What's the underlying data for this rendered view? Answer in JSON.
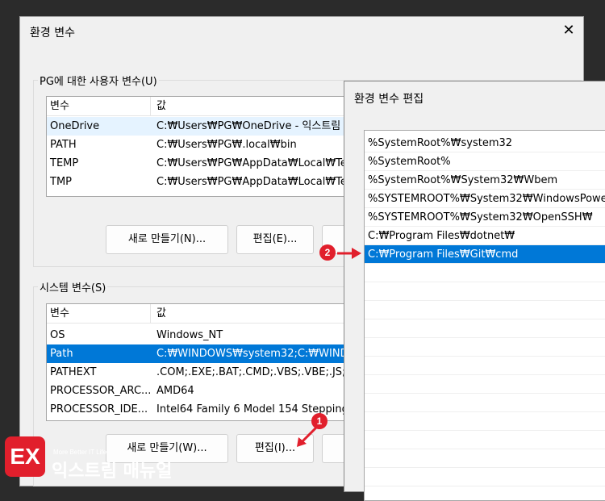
{
  "env_window": {
    "title": "환경 변수",
    "close_glyph": "✕",
    "user_group": {
      "label": "PG에 대한 사용자 변수(U)",
      "columns": [
        "변수",
        "값"
      ],
      "rows": [
        {
          "name": "OneDrive",
          "value": "C:₩Users₩PG₩OneDrive - 익스트림"
        },
        {
          "name": "PATH",
          "value": "C:₩Users₩PG₩.local₩bin"
        },
        {
          "name": "TEMP",
          "value": "C:₩Users₩PG₩AppData₩Local₩Tem"
        },
        {
          "name": "TMP",
          "value": "C:₩Users₩PG₩AppData₩Local₩Tem"
        }
      ],
      "new_button": "새로 만들기(N)...",
      "edit_button": "편집(E)..."
    },
    "system_group": {
      "label": "시스템 변수(S)",
      "columns": [
        "변수",
        "값"
      ],
      "rows": [
        {
          "name": "OS",
          "value": "Windows_NT"
        },
        {
          "name": "Path",
          "value": "C:₩WINDOWS₩system32;C:₩WINDO"
        },
        {
          "name": "PATHEXT",
          "value": ".COM;.EXE;.BAT;.CMD;.VBS;.VBE;.JS;.JS"
        },
        {
          "name": "PROCESSOR_ARC...",
          "value": "AMD64"
        },
        {
          "name": "PROCESSOR_IDE...",
          "value": "Intel64 Family 6 Model 154 Stepping"
        }
      ],
      "new_button": "새로 만들기(W)...",
      "edit_button": "편집(I)..."
    }
  },
  "edit_window": {
    "title": "환경 변수 편집",
    "items": [
      "%SystemRoot%₩system32",
      "%SystemRoot%",
      "%SystemRoot%₩System32₩Wbem",
      "%SYSTEMROOT%₩System32₩WindowsPower",
      "%SYSTEMROOT%₩System32₩OpenSSH₩",
      "C:₩Program Files₩dotnet₩",
      "C:₩Program Files₩Git₩cmd"
    ]
  },
  "annotations": {
    "step1": "1",
    "step2": "2",
    "marker_color": "#e11f2c"
  },
  "watermark": {
    "tagline": "More Better IT Life",
    "name": "익스트림 매뉴얼",
    "logo_letter": "EX"
  }
}
